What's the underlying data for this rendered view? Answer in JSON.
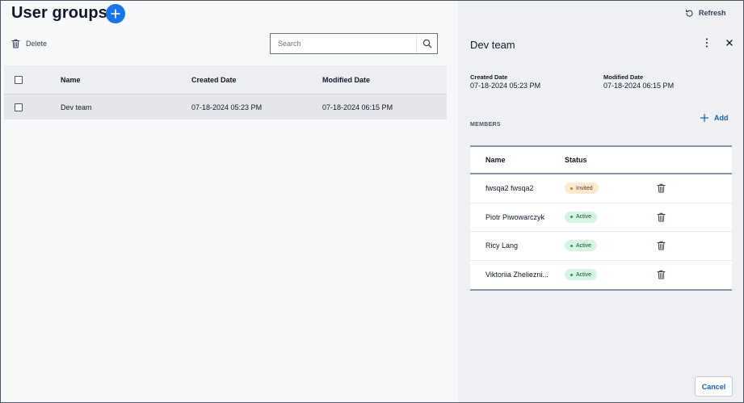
{
  "page": {
    "title": "User groups"
  },
  "toolbar": {
    "delete_label": "Delete",
    "refresh_label": "Refresh"
  },
  "search": {
    "placeholder": "Search",
    "value": ""
  },
  "grid": {
    "headers": {
      "name": "Name",
      "created": "Created Date",
      "modified": "Modified Date"
    },
    "rows": [
      {
        "name": "Dev team",
        "created": "07-18-2024 05:23 PM",
        "modified": "07-18-2024 06:15 PM"
      }
    ]
  },
  "panel": {
    "title": "Dev team",
    "created_label": "Created Date",
    "created_value": "07-18-2024 05:23 PM",
    "modified_label": "Modified Date",
    "modified_value": "07-18-2024 06:15 PM",
    "members_label": "MEMBERS",
    "add_label": "Add",
    "members_headers": {
      "name": "Name",
      "status": "Status"
    },
    "members": [
      {
        "name": "fwsqa2 fwsqa2",
        "status": "Invited",
        "kind": "invited"
      },
      {
        "name": "Piotr Piwowarczyk",
        "status": "Active",
        "kind": "active"
      },
      {
        "name": "Ricy Lang",
        "status": "Active",
        "kind": "active"
      },
      {
        "name": "Viktoriia Zhelieznі...",
        "status": "Active",
        "kind": "active"
      }
    ],
    "cancel_label": "Cancel"
  },
  "icons": {
    "add": "plus-icon",
    "delete": "trash-icon",
    "search": "search-icon",
    "refresh": "refresh-icon",
    "more": "kebab-icon",
    "close": "close-icon"
  },
  "colors": {
    "accent": "#1a73e8",
    "link": "#1a5fb4",
    "invited_bg": "#fde9d2",
    "active_bg": "#d7f3e3"
  }
}
